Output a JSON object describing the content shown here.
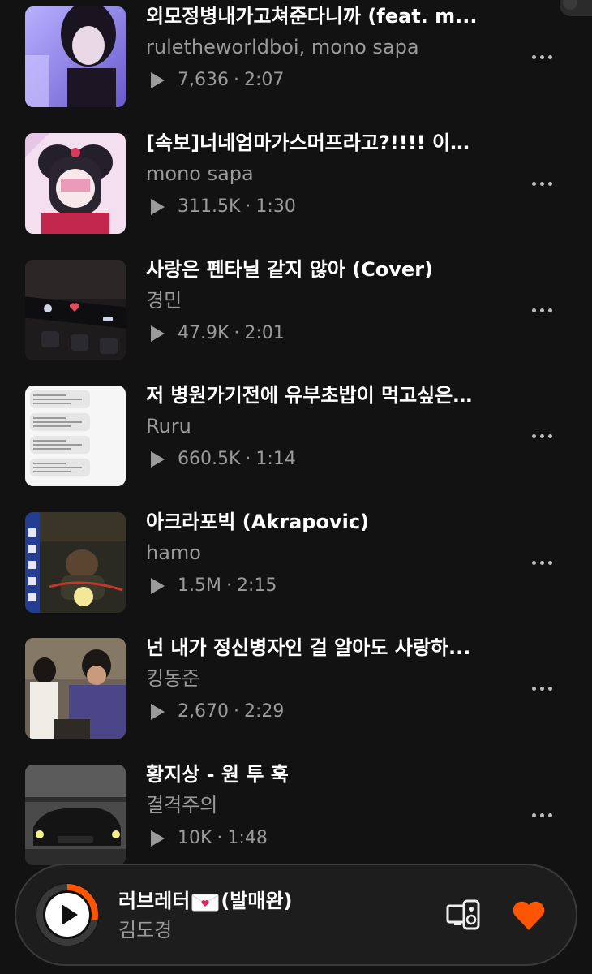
{
  "tracks": [
    {
      "title": "외모정병내가고쳐준다니까 (feat. m...",
      "artist": "ruletheworldboi, mono sapa",
      "plays": "7,636",
      "duration": "2:07",
      "art": "photo-purple"
    },
    {
      "title": "[속보]너네엄마가스머프라고?!!!! 이…",
      "artist": "mono sapa",
      "plays": "311.5K",
      "duration": "1:30",
      "art": "anime-pink"
    },
    {
      "title": "사랑은 펜타닐 같지 않아 (Cover)",
      "artist": "경민",
      "plays": "47.9K",
      "duration": "2:01",
      "art": "keyboard-dark"
    },
    {
      "title": "저 병원가기전에 유부초밥이 먹고싶은…",
      "artist": "Ruru",
      "plays": "660.5K",
      "duration": "1:14",
      "art": "text-messages"
    },
    {
      "title": "아크라포빅 (Akrapovic)",
      "artist": "hamo",
      "plays": "1.5M",
      "duration": "2:15",
      "art": "hamo-cover"
    },
    {
      "title": "넌 내가 정신병자인 걸 알아도 사랑하...",
      "artist": "킹동준",
      "plays": "2,670",
      "duration": "2:29",
      "art": "photo-room"
    },
    {
      "title": "황지상 - 원 투 훅",
      "artist": "결격주의",
      "plays": "10K",
      "duration": "1:48",
      "art": "black-car"
    }
  ],
  "now_playing": {
    "title_part1": "러브레터",
    "title_icon": "love-letter-icon",
    "title_part2": "(발매완)",
    "artist": "김도경",
    "progress": 0.28,
    "accent": "#ff5500"
  },
  "icons": {
    "more": "more-dots-icon",
    "play": "play-icon",
    "device": "cast-device-icon",
    "heart": "heart-icon"
  }
}
